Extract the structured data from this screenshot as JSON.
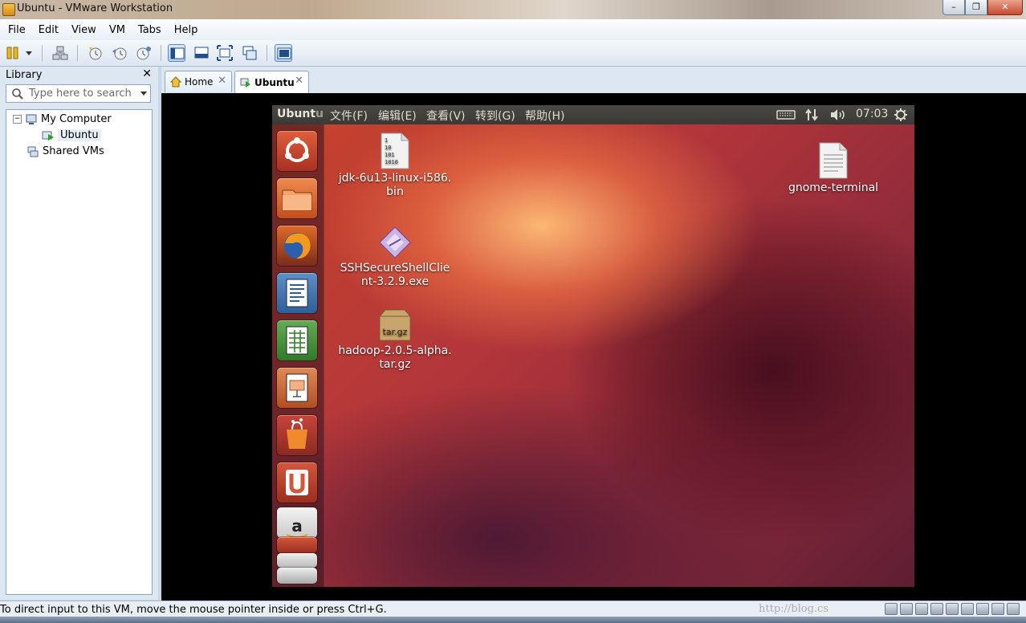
{
  "window": {
    "title": "Ubuntu - VMware Workstation",
    "controls": [
      "–",
      "❐",
      "✕"
    ]
  },
  "menubar": {
    "items": [
      "File",
      "Edit",
      "View",
      "VM",
      "Tabs",
      "Help"
    ]
  },
  "library": {
    "title": "Library",
    "close": "✕",
    "search_placeholder": "Type here to search",
    "tree": [
      {
        "label": "My Computer",
        "expander": "−"
      },
      {
        "label": "Ubuntu"
      },
      {
        "label": "Shared VMs"
      }
    ]
  },
  "tabs": [
    {
      "label": "Home",
      "close": "✕"
    },
    {
      "label": "Ubuntu",
      "close": "✕"
    }
  ],
  "guest": {
    "brand_main": "Ubunt",
    "brand_dim": "u",
    "menus": [
      "文件(F)",
      "编辑(E)",
      "查看(V)",
      "转到(G)",
      "帮助(H)"
    ],
    "clock": "07:03",
    "desktop_items": [
      {
        "line1": "jdk-6u13-linux-i586.",
        "line2": "bin",
        "icon_text": [
          "1",
          "10",
          "101",
          "1010"
        ]
      },
      {
        "line1": "SSHSecureShellClie",
        "line2": "nt-3.2.9.exe"
      },
      {
        "line1": "hadoop-2.0.5-alpha.",
        "line2": "tar.gz",
        "icon_text": "tar.gz"
      },
      {
        "line1": "gnome-terminal",
        "line2": ""
      }
    ],
    "launcher_icons": [
      "ubuntu-dash-icon",
      "home-folder-icon",
      "firefox-icon",
      "writer-icon",
      "calc-icon",
      "impress-icon",
      "software-center-icon",
      "ubuntu-one-icon",
      "amazon-icon"
    ]
  },
  "statusbar": {
    "message": "To direct input to this VM, move the mouse pointer inside or press Ctrl+G.",
    "watermark": "http://blog.cs"
  }
}
